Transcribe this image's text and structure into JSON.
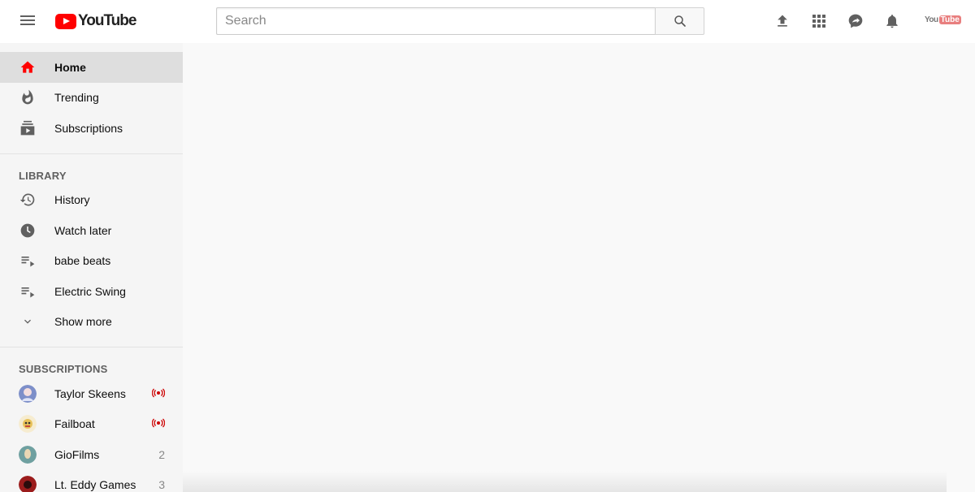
{
  "header": {
    "logo_text": "YouTube",
    "search_placeholder": "Search",
    "search_value": "",
    "account_logo_you": "You",
    "account_logo_tube": "Tube"
  },
  "colors": {
    "brand_red": "#ff0000",
    "live_red": "#cc0000",
    "sidebar_bg": "#f5f5f5",
    "active_bg": "#dedede",
    "icon_gray": "#606060"
  },
  "sidebar": {
    "main_items": [
      {
        "label": "Home",
        "icon": "home-icon",
        "active": true
      },
      {
        "label": "Trending",
        "icon": "fire-icon",
        "active": false
      },
      {
        "label": "Subscriptions",
        "icon": "subscriptions-icon",
        "active": false
      }
    ],
    "library_title": "LIBRARY",
    "library_items": [
      {
        "label": "History",
        "icon": "history-icon"
      },
      {
        "label": "Watch later",
        "icon": "clock-icon"
      },
      {
        "label": "babe beats",
        "icon": "playlist-icon"
      },
      {
        "label": "Electric Swing",
        "icon": "playlist-icon"
      },
      {
        "label": "Show more",
        "icon": "chevron-down-icon"
      }
    ],
    "subscriptions_title": "SUBSCRIPTIONS",
    "subscriptions": [
      {
        "label": "Taylor Skeens",
        "badge": "live",
        "avatar_color": "#7d8fc9"
      },
      {
        "label": "Failboat",
        "badge": "live",
        "avatar_color": "#e8c25a"
      },
      {
        "label": "GioFilms",
        "badge": "2",
        "avatar_color": "#6fa0a0"
      },
      {
        "label": "Lt. Eddy Games",
        "badge": "3",
        "avatar_color": "#9b1c1c"
      }
    ]
  }
}
